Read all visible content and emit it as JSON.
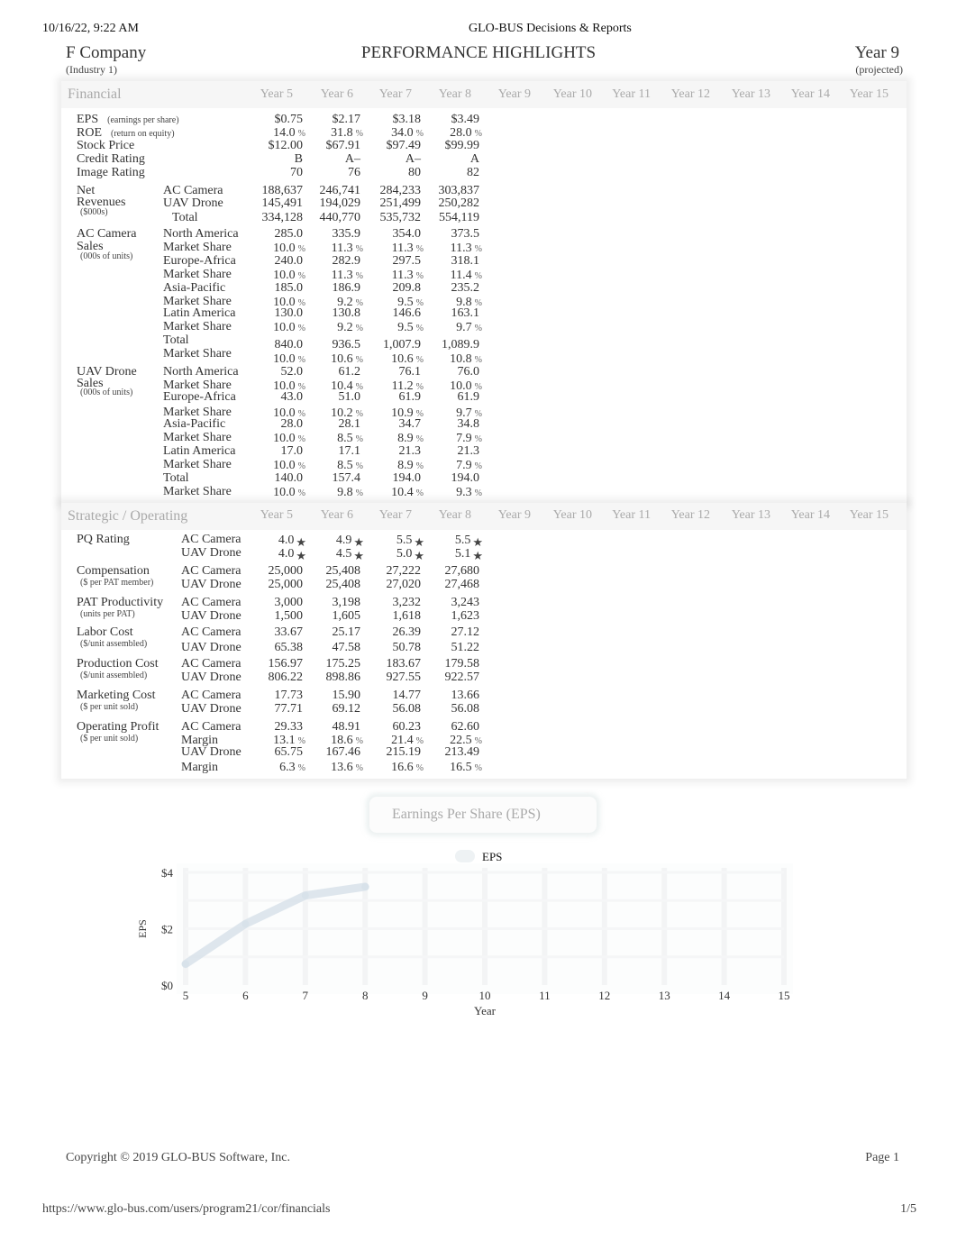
{
  "browser": {
    "datetime": "10/16/22, 9:22 AM",
    "page_title": "GLO-BUS Decisions & Reports",
    "url": "https://www.glo-bus.com/users/program21/cor/financials",
    "page_count": "1/5"
  },
  "header": {
    "company": "F Company",
    "industry": "(Industry 1)",
    "title": "PERFORMANCE HIGHLIGHTS",
    "year": "Year 9",
    "year_note": "(projected)"
  },
  "columns": [
    "Year 5",
    "Year 6",
    "Year 7",
    "Year 8",
    "Year 9",
    "Year 10",
    "Year 11",
    "Year 12",
    "Year 13",
    "Year 14",
    "Year 15"
  ],
  "financial": {
    "title": "Financial",
    "eps": {
      "label": "EPS",
      "note": "(earnings per share)",
      "values": [
        "$0.75",
        "$2.17",
        "$3.18",
        "$3.49"
      ]
    },
    "roe": {
      "label": "ROE",
      "note": "(return on equity)",
      "values": [
        "14.0",
        "31.8",
        "34.0",
        "28.0"
      ],
      "unit": "%"
    },
    "stock_price": {
      "label": "Stock Price",
      "values": [
        "$12.00",
        "$67.91",
        "$97.49",
        "$99.99"
      ]
    },
    "credit_rating": {
      "label": "Credit Rating",
      "values": [
        "B",
        "A–",
        "A–",
        "A"
      ]
    },
    "image_rating": {
      "label": "Image Rating",
      "values": [
        "70",
        "76",
        "80",
        "82"
      ]
    },
    "net_revenues": {
      "label1": "Net",
      "label2": "Revenues",
      "note": "($000s)",
      "rows": [
        {
          "label": "AC Camera",
          "values": [
            "188,637",
            "246,741",
            "284,233",
            "303,837"
          ]
        },
        {
          "label": "UAV Drone",
          "values": [
            "145,491",
            "194,029",
            "251,499",
            "250,282"
          ]
        },
        {
          "label": "Total",
          "values": [
            "334,128",
            "440,770",
            "535,732",
            "554,119"
          ]
        }
      ]
    },
    "ac_sales": {
      "label1": "AC Camera",
      "label2": "Sales",
      "note": "(000s of units)",
      "rows": [
        {
          "label": "North America",
          "values": [
            "285.0",
            "335.9",
            "354.0",
            "373.5"
          ]
        },
        {
          "label": "Market Share",
          "values": [
            "10.0",
            "11.3",
            "11.3",
            "11.3"
          ],
          "unit": "%"
        },
        {
          "label": "Europe-Africa",
          "values": [
            "240.0",
            "282.9",
            "297.5",
            "318.1"
          ]
        },
        {
          "label": "Market Share",
          "values": [
            "10.0",
            "11.3",
            "11.3",
            "11.4"
          ],
          "unit": "%"
        },
        {
          "label": "Asia-Pacific",
          "values": [
            "185.0",
            "186.9",
            "209.8",
            "235.2"
          ]
        },
        {
          "label": "Market Share",
          "values": [
            "10.0",
            "9.2",
            "9.5",
            "9.8"
          ],
          "unit": "%"
        },
        {
          "label": "Latin America",
          "values": [
            "130.0",
            "130.8",
            "146.6",
            "163.1"
          ]
        },
        {
          "label": "Market Share",
          "values": [
            "10.0",
            "9.2",
            "9.5",
            "9.7"
          ],
          "unit": "%"
        },
        {
          "label": "Total",
          "values": [
            "840.0",
            "936.5",
            "1,007.9",
            "1,089.9"
          ]
        },
        {
          "label": "Market Share",
          "values": [
            "10.0",
            "10.6",
            "10.6",
            "10.8"
          ],
          "unit": "%"
        }
      ]
    },
    "uav_sales": {
      "label1": "UAV Drone",
      "label2": "Sales",
      "note": "(000s of units)",
      "rows": [
        {
          "label": "North America",
          "values": [
            "52.0",
            "61.2",
            "76.1",
            "76.0"
          ]
        },
        {
          "label": "Market Share",
          "values": [
            "10.0",
            "10.4",
            "11.2",
            "10.0"
          ],
          "unit": "%"
        },
        {
          "label": "Europe-Africa",
          "values": [
            "43.0",
            "51.0",
            "61.9",
            "61.9"
          ]
        },
        {
          "label": "Market Share",
          "values": [
            "10.0",
            "10.2",
            "10.9",
            "9.7"
          ],
          "unit": "%"
        },
        {
          "label": "Asia-Pacific",
          "values": [
            "28.0",
            "28.1",
            "34.7",
            "34.8"
          ]
        },
        {
          "label": "Market Share",
          "values": [
            "10.0",
            "8.5",
            "8.9",
            "7.9"
          ],
          "unit": "%"
        },
        {
          "label": "Latin America",
          "values": [
            "17.0",
            "17.1",
            "21.3",
            "21.3"
          ]
        },
        {
          "label": "Market Share",
          "values": [
            "10.0",
            "8.5",
            "8.9",
            "7.9"
          ],
          "unit": "%"
        },
        {
          "label": "Total",
          "values": [
            "140.0",
            "157.4",
            "194.0",
            "194.0"
          ]
        },
        {
          "label": "Market Share",
          "values": [
            "10.0",
            "9.8",
            "10.4",
            "9.3"
          ],
          "unit": "%"
        }
      ]
    }
  },
  "strategic": {
    "title": "Strategic / Operating",
    "star_icon": "star-icon",
    "groups": [
      {
        "label": "PQ Rating",
        "note": "",
        "rows": [
          {
            "label": "AC Camera",
            "values": [
              "4.0",
              "4.9",
              "5.5",
              "5.5"
            ],
            "star": true
          },
          {
            "label": "UAV Drone",
            "values": [
              "4.0",
              "4.5",
              "5.0",
              "5.1"
            ],
            "star": true
          }
        ]
      },
      {
        "label": "Compensation",
        "note": "($ per PAT member)",
        "rows": [
          {
            "label": "AC Camera",
            "values": [
              "25,000",
              "25,408",
              "27,222",
              "27,680"
            ]
          },
          {
            "label": "UAV Drone",
            "values": [
              "25,000",
              "25,408",
              "27,020",
              "27,468"
            ]
          }
        ]
      },
      {
        "label": "PAT Productivity",
        "note": "(units per PAT)",
        "rows": [
          {
            "label": "AC Camera",
            "values": [
              "3,000",
              "3,198",
              "3,232",
              "3,243"
            ]
          },
          {
            "label": "UAV Drone",
            "values": [
              "1,500",
              "1,605",
              "1,618",
              "1,623"
            ]
          }
        ]
      },
      {
        "label": "Labor Cost",
        "note": "($/unit assembled)",
        "rows": [
          {
            "label": "AC Camera",
            "values": [
              "33.67",
              "25.17",
              "26.39",
              "27.12"
            ]
          },
          {
            "label": "UAV Drone",
            "values": [
              "65.38",
              "47.58",
              "50.78",
              "51.22"
            ]
          }
        ]
      },
      {
        "label": "Production Cost",
        "note": "($/unit assembled)",
        "rows": [
          {
            "label": "AC Camera",
            "values": [
              "156.97",
              "175.25",
              "183.67",
              "179.58"
            ]
          },
          {
            "label": "UAV Drone",
            "values": [
              "806.22",
              "898.86",
              "927.55",
              "922.57"
            ]
          }
        ]
      },
      {
        "label": "Marketing Cost",
        "note": "($ per unit sold)",
        "rows": [
          {
            "label": "AC Camera",
            "values": [
              "17.73",
              "15.90",
              "14.77",
              "13.66"
            ]
          },
          {
            "label": "UAV Drone",
            "values": [
              "77.71",
              "69.12",
              "56.08",
              "56.08"
            ]
          }
        ]
      },
      {
        "label": "Operating Profit",
        "note": "($ per unit sold)",
        "rows": [
          {
            "label": "AC Camera",
            "values": [
              "29.33",
              "48.91",
              "60.23",
              "62.60"
            ]
          },
          {
            "label": "Margin",
            "values": [
              "13.1",
              "18.6",
              "21.4",
              "22.5"
            ],
            "unit": "%"
          },
          {
            "label": "UAV Drone",
            "values": [
              "65.75",
              "167.46",
              "215.19",
              "213.49"
            ]
          },
          {
            "label": "Margin",
            "values": [
              "6.3",
              "13.6",
              "16.6",
              "16.5"
            ],
            "unit": "%"
          }
        ]
      }
    ]
  },
  "chart_data": {
    "type": "line",
    "title": "Earnings Per Share (EPS)",
    "legend": [
      "EPS"
    ],
    "legend_placement": "top-center",
    "xlabel": "Year",
    "ylabel": "EPS",
    "x": [
      5,
      6,
      7,
      8
    ],
    "x_ticks": [
      "5",
      "6",
      "7",
      "8",
      "9",
      "10",
      "11",
      "12",
      "13",
      "14",
      "15"
    ],
    "xlim": [
      5,
      15
    ],
    "y_ticks": [
      "$0",
      "$2",
      "$4"
    ],
    "ylim": [
      0,
      4
    ],
    "grid": true,
    "series": [
      {
        "name": "EPS",
        "values": [
          0.75,
          2.17,
          3.18,
          3.49
        ],
        "color": "#d8e2ea"
      }
    ]
  },
  "footer": {
    "copyright": "Copyright © 2019 GLO-BUS Software, Inc.",
    "page": "Page 1"
  }
}
